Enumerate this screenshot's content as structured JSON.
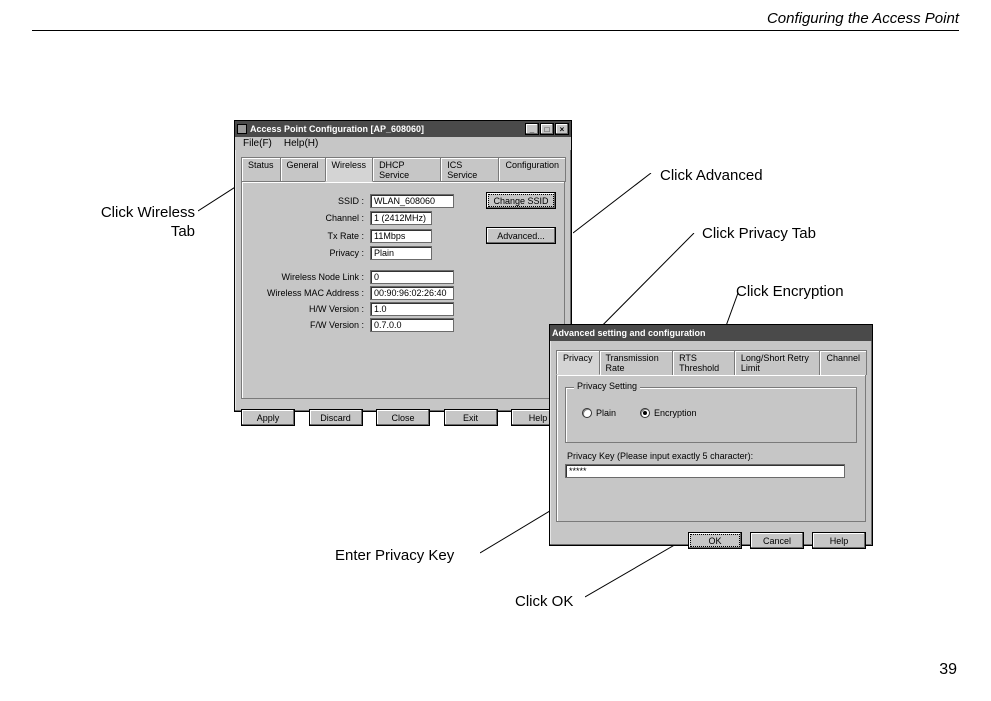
{
  "page": {
    "header": "Configuring the Access Point",
    "number": "39"
  },
  "callouts": {
    "wireless_tab": "Click Wireless Tab",
    "advanced": "Click Advanced",
    "privacy_tab": "Click Privacy Tab",
    "encryption": "Click Encryption",
    "privacy_key": "Enter Privacy Key",
    "ok": "Click OK"
  },
  "main_window": {
    "title": "Access Point Configuration [AP_608060]",
    "menus": {
      "file": "File(F)",
      "help": "Help(H)"
    },
    "tabs": {
      "status": "Status",
      "general": "General",
      "wireless": "Wireless",
      "dhcp": "DHCP Service",
      "ics": "ICS Service",
      "configuration": "Configuration"
    },
    "fields": {
      "ssid_label": "SSID :",
      "ssid_value": "WLAN_608060",
      "ssid_button": "Change SSID",
      "channel_label": "Channel :",
      "channel_value": "1 (2412MHz)",
      "txrate_label": "Tx Rate :",
      "txrate_value": "11Mbps",
      "privacy_label": "Privacy :",
      "privacy_value": "Plain",
      "nodelink_label": "Wireless Node Link :",
      "nodelink_value": "0",
      "mac_label": "Wireless MAC Address :",
      "mac_value": "00:90:96:02:26:40",
      "hw_label": "H/W Version :",
      "hw_value": "1.0",
      "fw_label": "F/W Version :",
      "fw_value": "0.7.0.0",
      "advanced_button": "Advanced..."
    },
    "buttons": {
      "apply": "Apply",
      "discard": "Discard",
      "close": "Close",
      "exit": "Exit",
      "help": "Help"
    }
  },
  "adv_window": {
    "title": "Advanced setting and configuration",
    "tabs": {
      "privacy": "Privacy",
      "txrate": "Transmission Rate",
      "rts": "RTS Threshold",
      "retry": "Long/Short Retry Limit",
      "channel": "Channel"
    },
    "group_legend": "Privacy Setting",
    "radio_plain": "Plain",
    "radio_encryption": "Encryption",
    "key_label": "Privacy Key (Please input exactly 5 character):",
    "key_value": "*****",
    "buttons": {
      "ok": "OK",
      "cancel": "Cancel",
      "help": "Help"
    }
  }
}
